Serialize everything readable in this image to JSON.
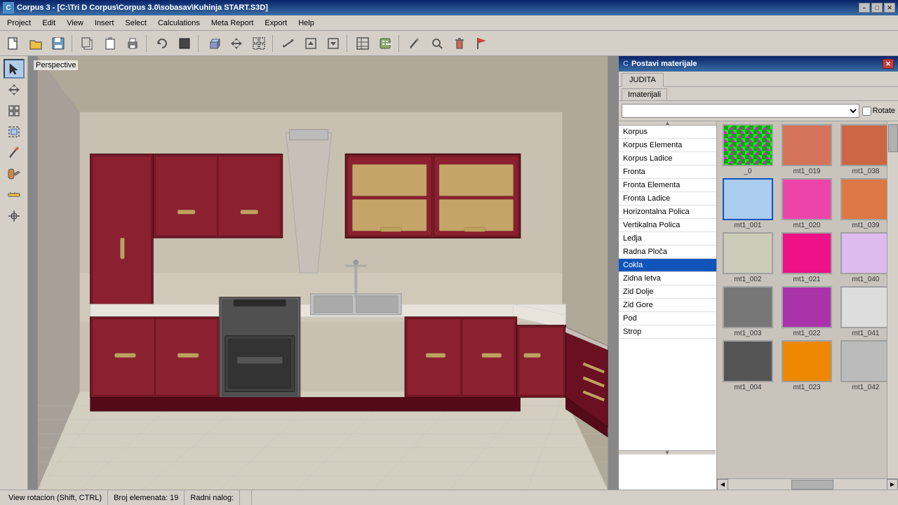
{
  "titlebar": {
    "icon": "C",
    "title": "Corpus 3 - [C:\\Tri D Corpus\\Corpus 3.0\\sobasav\\Kuhinja START.S3D]",
    "minimize": "–",
    "maximize": "□",
    "close": "✕",
    "app_minimize": "–",
    "app_restore": "▪",
    "app_close": "✕"
  },
  "menubar": {
    "items": [
      "Project",
      "Edit",
      "View",
      "Insert",
      "Select",
      "Calculations",
      "Meta Report",
      "Export",
      "Help"
    ]
  },
  "viewport": {
    "label": "Perspective"
  },
  "panel": {
    "title_icon": "C",
    "title": "Postavi materijale",
    "close": "✕",
    "tab": "JUDITA",
    "subtab": "Imaterijali",
    "dropdown_value": "",
    "rotate_label": "Rotate",
    "categories": [
      {
        "label": "Korpus",
        "selected": false
      },
      {
        "label": "Korpus Elementa",
        "selected": false
      },
      {
        "label": "Korpus Ladice",
        "selected": false
      },
      {
        "label": "Fronta",
        "selected": false
      },
      {
        "label": "Fronta Elementa",
        "selected": false
      },
      {
        "label": "Fronta Ladice",
        "selected": false
      },
      {
        "label": "Horizontalna Polica",
        "selected": false
      },
      {
        "label": "Vertikalna Polica",
        "selected": false
      },
      {
        "label": "Leđja",
        "selected": false
      },
      {
        "label": "Radna Ploča",
        "selected": false
      },
      {
        "label": "Cokla",
        "selected": true
      },
      {
        "label": "Zidna letva",
        "selected": false
      },
      {
        "label": "Zid Dolje",
        "selected": false
      },
      {
        "label": "Zid Gore",
        "selected": false
      },
      {
        "label": "Pod",
        "selected": false
      },
      {
        "label": "Strop",
        "selected": false
      }
    ],
    "materials": [
      {
        "id": "_0",
        "label": "_0",
        "color": "checkered",
        "selected": false
      },
      {
        "id": "mt1_019",
        "label": "mt1_019",
        "color": "#d4735a",
        "selected": false
      },
      {
        "id": "mt1_038",
        "label": "mt1_038",
        "color": "#cc6644",
        "selected": false
      },
      {
        "id": "mt1_001",
        "label": "mt1_001",
        "color": "#aaccee",
        "selected": true
      },
      {
        "id": "mt1_020",
        "label": "mt1_020",
        "color": "#ee44aa",
        "selected": false
      },
      {
        "id": "mt1_039",
        "label": "mt1_039",
        "color": "#dd7744",
        "selected": false
      },
      {
        "id": "mt1_002",
        "label": "mt1_002",
        "color": "#ccccbb",
        "selected": false
      },
      {
        "id": "mt1_021",
        "label": "mt1_021",
        "color": "#ee1188",
        "selected": false
      },
      {
        "id": "mt1_040",
        "label": "mt1_040",
        "color": "#ee88ee",
        "selected": false
      },
      {
        "id": "mt1_003",
        "label": "mt1_003",
        "color": "#777777",
        "selected": false
      },
      {
        "id": "mt1_022",
        "label": "mt1_022",
        "color": "#aa33aa",
        "selected": false
      },
      {
        "id": "mt1_041",
        "label": "mt1_041",
        "color": "#dddddd",
        "selected": false
      },
      {
        "id": "mt1_004",
        "label": "mt1_004",
        "color": "#555555",
        "selected": false
      },
      {
        "id": "mt1_023",
        "label": "mt1_023",
        "color": "#ee8800",
        "selected": false
      },
      {
        "id": "mt1_042",
        "label": "mt1_042",
        "color": "#bbbbbb",
        "selected": false
      }
    ]
  },
  "statusbar": {
    "view_rotation": "View rotacion (Shift, CTRL)",
    "elements_label": "Broj elemenata: 19",
    "radni_label": "Radni nalog:"
  },
  "toolbar": {
    "buttons": [
      "📄",
      "📂",
      "💾",
      "📋",
      "📌",
      "🖨",
      "↩",
      "⬛",
      "📦",
      "📤",
      "📥",
      "📊",
      "🔧",
      "✂",
      "📐",
      "📏",
      "🖊",
      "🔍",
      "🗑"
    ]
  }
}
